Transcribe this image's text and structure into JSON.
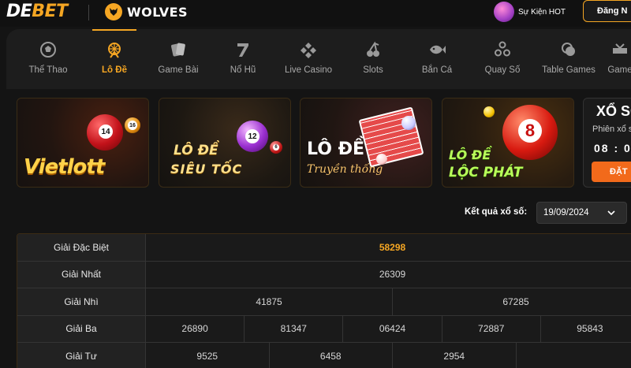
{
  "header": {
    "logo_de": "DE",
    "logo_bet": "BET",
    "partner": "WOLVES",
    "event_label": "Sự Kiện HOT",
    "login_label": "Đăng N"
  },
  "nav": {
    "items": [
      {
        "label": "Thể Thao",
        "icon": "soccer-ball-icon"
      },
      {
        "label": "Lô Đề",
        "icon": "ferris-wheel-icon",
        "active": true
      },
      {
        "label": "Game Bài",
        "icon": "cards-icon"
      },
      {
        "label": "Nổ Hũ",
        "icon": "slot-seven-icon"
      },
      {
        "label": "Live Casino",
        "icon": "diamond-icon"
      },
      {
        "label": "Slots",
        "icon": "cherry-icon"
      },
      {
        "label": "Bắn Cá",
        "icon": "fish-icon"
      },
      {
        "label": "Quay Số",
        "icon": "lottery-balls-icon"
      },
      {
        "label": "Table Games",
        "icon": "chips-icon"
      },
      {
        "label": "Game",
        "icon": "game-icon"
      }
    ]
  },
  "banners": [
    {
      "title": "Vietlott",
      "ball_numbers": [
        "14",
        "16"
      ]
    },
    {
      "title_line1": "LÔ ĐỀ",
      "title_line2": "SIÊU TỐC",
      "ball_numbers": [
        "12",
        "6"
      ]
    },
    {
      "title_line1": "LÔ ĐỀ",
      "title_line2": "Truyền thống"
    },
    {
      "title_line1": "LÔ ĐỀ",
      "title_line2": "LỘC PHÁT",
      "ball_numbers": [
        "8"
      ]
    }
  ],
  "widget": {
    "title": "XỔ SỐ",
    "subtitle": "Phiên xổ s",
    "time": "08 : 0",
    "button": "ĐẶT"
  },
  "results": {
    "label": "Kết quả xổ số:",
    "date": "19/09/2024",
    "rows": [
      {
        "name": "Giải Đặc Biệt",
        "values": [
          "58298"
        ],
        "special": true
      },
      {
        "name": "Giải Nhất",
        "values": [
          "26309"
        ]
      },
      {
        "name": "Giải Nhì",
        "values": [
          "41875",
          "67285"
        ]
      },
      {
        "name": "Giải Ba",
        "values": [
          "26890",
          "81347",
          "06424",
          "72887",
          "95843"
        ]
      },
      {
        "name": "Giải Tư",
        "values": [
          "9525",
          "6458",
          "2954",
          ""
        ]
      }
    ]
  },
  "colors": {
    "accent": "#f5a623",
    "background": "#141414",
    "button_orange": "#f26a1b"
  }
}
